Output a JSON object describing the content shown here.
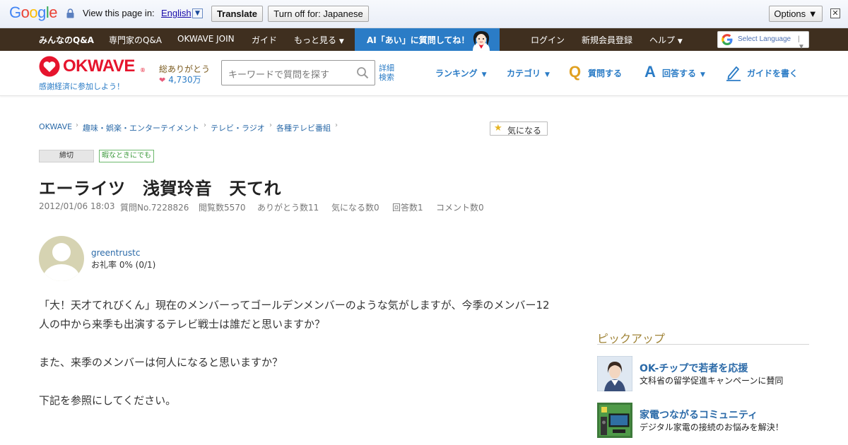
{
  "translate_bar": {
    "logo": "Google",
    "view_text": "View this page in:",
    "language": "English",
    "translate_button": "Translate",
    "turn_off_button": "Turn off for: Japanese",
    "options_button": "Options ▼",
    "close": "✕"
  },
  "topnav": {
    "items": [
      "みんなのQ&A",
      "専門家のQ&A",
      "OKWAVE JOIN",
      "ガイド",
      "もっと見る"
    ],
    "ai_banner": "AI「あい」に質問してね！",
    "right_items": [
      "ログイン",
      "新規会員登録",
      "ヘルプ"
    ],
    "select_language": "Select Language",
    "select_arrow": "| ▼"
  },
  "header": {
    "logo": "OKWAVE",
    "logo_mark": "®",
    "tagline": "感謝経済に参加しよう！",
    "thanks_label": "総ありがとう",
    "thanks_count": "4,730万",
    "search_placeholder": "キーワードで質問を探す",
    "advanced_1": "詳細",
    "advanced_2": "検索",
    "nav": {
      "ranking": "ランキング",
      "category": "カテゴリ",
      "ask": "質問する",
      "answer": "回答する",
      "guide": "ガイドを書く"
    },
    "q_letter": "Q",
    "a_letter": "A"
  },
  "breadcrumb": [
    "OKWAVE",
    "趣味・娯楽・エンターテイメント",
    "テレビ・ラジオ",
    "各種テレビ番組"
  ],
  "watch_button": "気になる",
  "tags": [
    "締切",
    "暇なときにでも"
  ],
  "question": {
    "title": "エーライツ　浅賀玲音　天てれ",
    "meta": [
      "2012/01/06 18:03",
      "質問No.7228826",
      "閲覧数5570",
      "ありがとう数11",
      "気になる数0",
      "回答数1",
      "コメント数0"
    ],
    "user_name": "greentrustc",
    "user_rate": "お礼率 0%   (0/1)",
    "body": [
      "「大！天才てれびくん」現在のメンバーってゴールデンメンバーのような気がしますが、今季のメンバー12人の中から来季も出演するテレビ戦士は誰だと思いますか？",
      "また、来季のメンバーは何人になると思いますか？",
      "下記を参照にしてください。"
    ]
  },
  "sidebar": {
    "pickup_title": "ピックアップ",
    "items": [
      {
        "title": "OK-チップで若者を応援",
        "desc": "文科省の留学促進キャンペーンに賛同"
      },
      {
        "title": "家電つながるコミュニティ",
        "desc": "デジタル家電の接続のお悩みを解決！"
      }
    ]
  },
  "colors": {
    "brand_red": "#e6142d",
    "link_blue": "#2b7cc6",
    "nav_brown": "#3f2f1f",
    "pickup_gold": "#a08438"
  }
}
